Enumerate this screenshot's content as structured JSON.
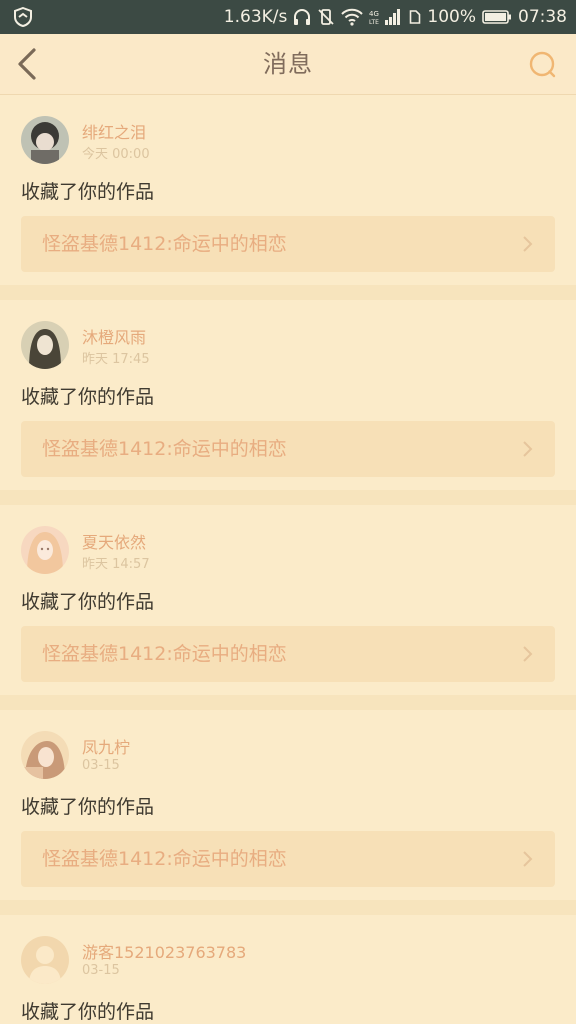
{
  "status_bar": {
    "speed": "1.63K/s",
    "battery": "100%",
    "time": "07:38",
    "icons": [
      "shield-icon",
      "headphones-icon",
      "vibrate-off-icon",
      "wifi-icon",
      "4g-lte-signal-icon",
      "sim-icon",
      "battery-icon"
    ]
  },
  "header": {
    "title": "消息",
    "back_icon": "back-arrow-icon",
    "search_icon": "search-icon"
  },
  "colors": {
    "background": "#f9ebcb",
    "status_bar": "#3c4a44",
    "username": "#e5a97b",
    "work_link": "#e8ad81",
    "work_bg": "#f7e0b7"
  },
  "messages": [
    {
      "user": "绯红之泪",
      "time": "今天 00:00",
      "action": "收藏了你的作品",
      "work": "怪盗基德1412:命运中的相恋"
    },
    {
      "user": "沐橙风雨",
      "time": "昨天 17:45",
      "action": "收藏了你的作品",
      "work": "怪盗基德1412:命运中的相恋"
    },
    {
      "user": "夏天依然",
      "time": "昨天 14:57",
      "action": "收藏了你的作品",
      "work": "怪盗基德1412:命运中的相恋"
    },
    {
      "user": "凤九柠",
      "time": "03-15",
      "action": "收藏了你的作品",
      "work": "怪盗基德1412:命运中的相恋"
    },
    {
      "user": "游客1521023763783",
      "time": "03-15",
      "action": "收藏了你的作品",
      "work": ""
    }
  ]
}
